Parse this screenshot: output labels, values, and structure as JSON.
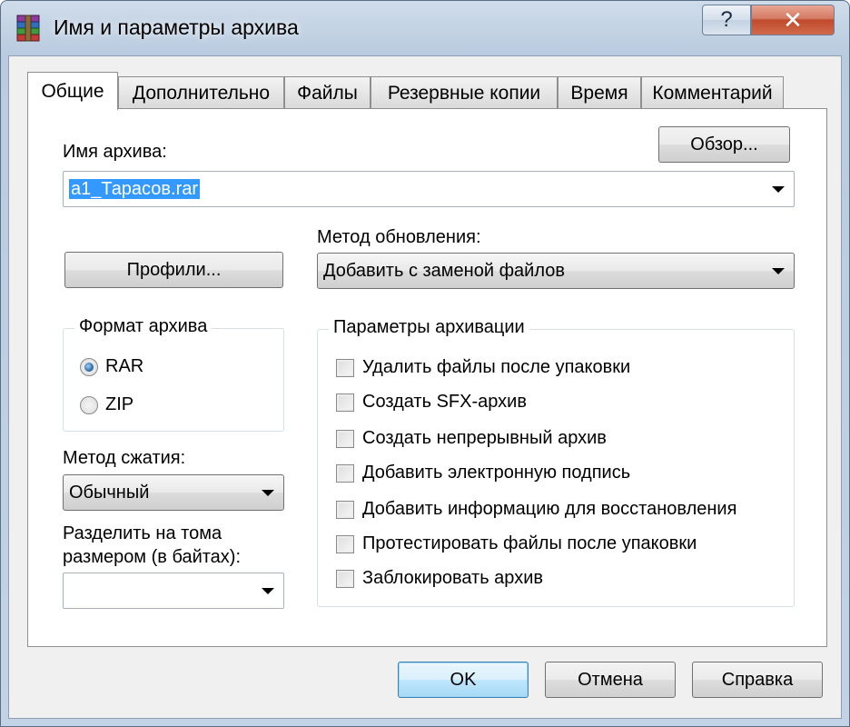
{
  "window": {
    "title": "Имя и параметры архива",
    "help_glyph": "?",
    "close_glyph": "✕"
  },
  "tabs": [
    {
      "label": "Общие",
      "active": true
    },
    {
      "label": "Дополнительно"
    },
    {
      "label": "Файлы"
    },
    {
      "label": "Резервные копии"
    },
    {
      "label": "Время"
    },
    {
      "label": "Комментарий"
    }
  ],
  "general": {
    "archive_name_label": "Имя архива:",
    "browse_button": "Обзор...",
    "archive_name_value": "a1_Тарасов.rar",
    "profiles_button": "Профили...",
    "update_method_label": "Метод обновления:",
    "update_method_value": "Добавить с заменой файлов",
    "format": {
      "title": "Формат архива",
      "options": [
        "RAR",
        "ZIP"
      ],
      "selected": "RAR"
    },
    "compression_label": "Метод сжатия:",
    "compression_value": "Обычный",
    "split_label_line1": "Разделить на тома",
    "split_label_line2": "размером (в байтах):",
    "split_value": "",
    "archiving_options": {
      "title": "Параметры архивации",
      "items": [
        {
          "label": "Удалить файлы после упаковки",
          "checked": false
        },
        {
          "label": "Создать SFX-архив",
          "checked": false
        },
        {
          "label": "Создать непрерывный архив",
          "checked": false
        },
        {
          "label": "Добавить электронную подпись",
          "checked": false
        },
        {
          "label": "Добавить информацию для восстановления",
          "checked": false
        },
        {
          "label": "Протестировать файлы после упаковки",
          "checked": false
        },
        {
          "label": "Заблокировать архив",
          "checked": false
        }
      ]
    }
  },
  "footer": {
    "ok": "OK",
    "cancel": "Отмена",
    "help": "Справка"
  },
  "colors": {
    "selection": "#3399ff",
    "default_button": "#bee6fd",
    "close_button": "#c04a2e"
  },
  "icons": {
    "app": "winrar-books-icon",
    "help": "question-mark-icon",
    "close": "close-icon",
    "dropdown": "chevron-down-icon"
  }
}
